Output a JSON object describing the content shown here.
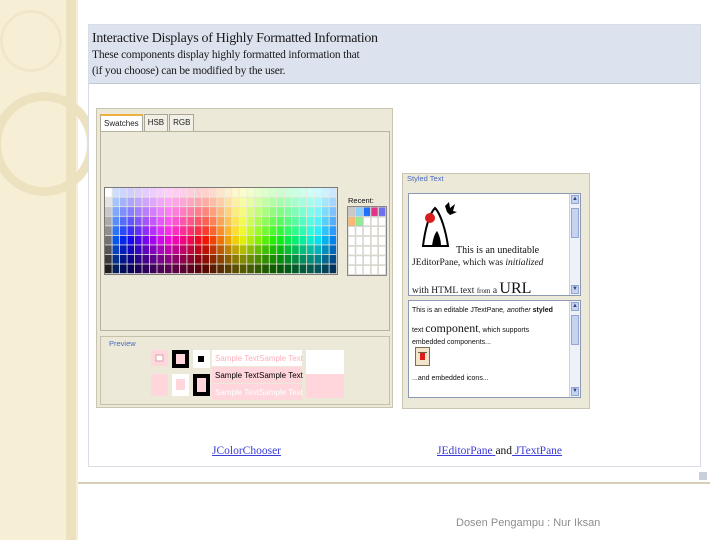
{
  "slide": {
    "footer": "Dosen Pengampu : Nur Iksan"
  },
  "demo": {
    "title": "Interactive Displays of Highly Formatted Information",
    "description_line1": "These components display highly formatted information that",
    "description_line2": "(if you choose) can be modified by the user."
  },
  "color_chooser": {
    "tabs": [
      "Swatches",
      "HSB",
      "RGB"
    ],
    "recent_label": "Recent:",
    "preview_label": "Preview",
    "sample_text": "Sample Text",
    "caption": "JColorChooser",
    "recent_colors": [
      "#c8c8c8",
      "#8ad0ff",
      "#1f6fff",
      "#e0338c",
      "#6f6fef",
      "#ffb86b",
      "#8df08d"
    ]
  },
  "styled_text": {
    "label": "Styled Text",
    "pane1": {
      "line1": "This is an uneditable",
      "line2_a": "JEditorPane, which was ",
      "line2_italic": "initialized",
      "line3_a": "with HTML text ",
      "line3_from": "from",
      "line3_a2": " a ",
      "line3_big": "URL"
    },
    "pane2": {
      "line1_a": "This is an editable ",
      "line1_b": "JTextPane",
      "line1_c": ", another ",
      "line1_bold": "styled",
      "line2_a": "text ",
      "line2_big": "component",
      "line2_b": ", which supports",
      "line3": "embedded components...",
      "line4": "...and embedded icons..."
    },
    "caption_a": "JEditorPane",
    "caption_and": "and",
    "caption_b": "JTextPane"
  },
  "colors": {
    "title_panel_bg": "#dde2ef",
    "window_bg": "#ece9d8",
    "link": "#3b3bd6",
    "accent_label": "#4a6bbf"
  }
}
